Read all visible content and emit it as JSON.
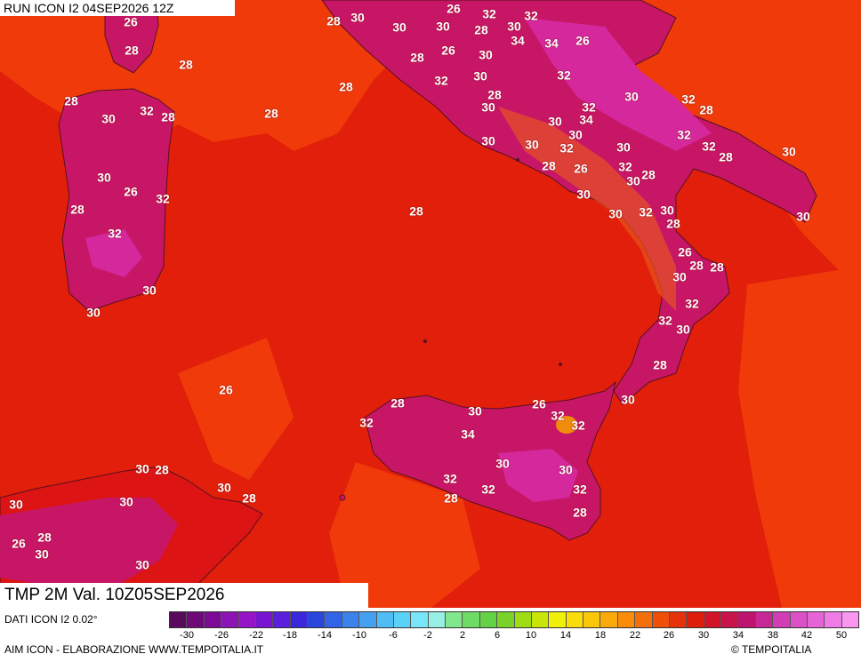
{
  "header": {
    "run_label": "RUN ICON I2 04SEP2026 12Z"
  },
  "map": {
    "variable_label": "TMP 2M Val. 10Z05SEP2026",
    "colors": {
      "sea_main": "#e21f0a",
      "sea_warm": "#f03a0a",
      "land_hot": "#c81666",
      "land_very_hot": "#d4289c",
      "land_warm": "#dc1414",
      "coast": "#5a1020"
    },
    "contour_labels": [
      "26",
      "28",
      "30",
      "28",
      "28",
      "30",
      "26",
      "30",
      "28",
      "32",
      "30",
      "32",
      "34",
      "34",
      "26",
      "26",
      "30",
      "28",
      "32",
      "30",
      "28",
      "28",
      "28",
      "30",
      "32",
      "28",
      "28",
      "30",
      "32",
      "30",
      "32",
      "28",
      "32",
      "30",
      "34",
      "30",
      "32",
      "32",
      "28",
      "30",
      "30",
      "32",
      "30",
      "28",
      "26",
      "30",
      "32",
      "28",
      "30",
      "30",
      "30",
      "32",
      "30",
      "28",
      "30",
      "30",
      "26",
      "32",
      "28",
      "32",
      "28",
      "26",
      "28",
      "28",
      "30",
      "32",
      "30",
      "30",
      "32",
      "30",
      "28",
      "30",
      "26",
      "28",
      "30",
      "26",
      "32",
      "32",
      "32",
      "34",
      "30",
      "30",
      "32",
      "32",
      "28",
      "32",
      "28",
      "30",
      "28",
      "30",
      "28",
      "30",
      "30",
      "28",
      "26",
      "30",
      "30"
    ]
  },
  "footer": {
    "data_source": "DATI ICON I2 0.02°",
    "credits": "AIM ICON - ELABORAZIONE WWW.TEMPOITALIA.IT",
    "copyright": "© TEMPOITALIA"
  },
  "legend": {
    "tick_labels": [
      "-30",
      "-26",
      "-22",
      "-18",
      "-14",
      "-10",
      "-6",
      "-2",
      "2",
      "6",
      "10",
      "14",
      "18",
      "22",
      "26",
      "30",
      "34",
      "38",
      "42",
      "50"
    ],
    "colors": [
      "#5a0a5a",
      "#6e0a78",
      "#7d0a96",
      "#8c14b4",
      "#9614c8",
      "#7814d2",
      "#5a1edc",
      "#3c28dc",
      "#2846dc",
      "#3264e6",
      "#3c82ec",
      "#46a0f0",
      "#50bef4",
      "#5ad2f8",
      "#78e6f8",
      "#96f0e6",
      "#82e68c",
      "#6edc64",
      "#64d246",
      "#78d228",
      "#a0dc14",
      "#c8e60a",
      "#f0f00a",
      "#fadc0a",
      "#fac80a",
      "#faaa0a",
      "#fa8c0a",
      "#f46e0a",
      "#ee500a",
      "#e6320a",
      "#dc1e0a",
      "#d21428",
      "#c8144b",
      "#be146e",
      "#c82896",
      "#d23cb4",
      "#dc50c8",
      "#e664d8",
      "#f07ae6",
      "#f896f0"
    ]
  }
}
